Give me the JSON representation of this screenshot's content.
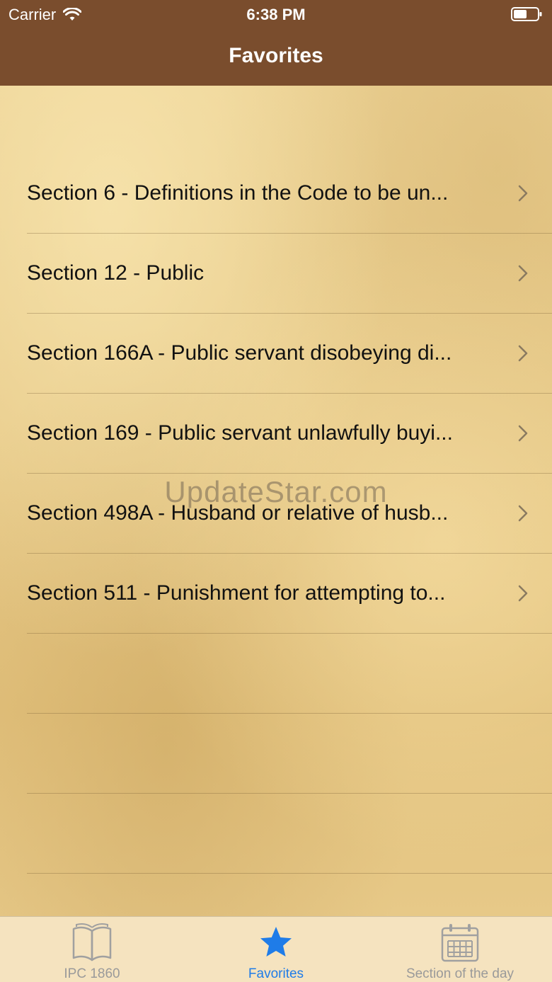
{
  "status_bar": {
    "carrier": "Carrier",
    "time": "6:38 PM",
    "wifi_icon": "wifi-icon",
    "battery_icon": "battery-icon"
  },
  "nav": {
    "title": "Favorites"
  },
  "favorites": [
    {
      "label": "Section 6 - Definitions in the Code to be un..."
    },
    {
      "label": "Section 12 - Public"
    },
    {
      "label": "Section 166A - Public servant disobeying di..."
    },
    {
      "label": "Section 169 - Public servant unlawfully buyi..."
    },
    {
      "label": "Section 498A - Husband or relative of husb..."
    },
    {
      "label": "Section 511 - Punishment for attempting to..."
    }
  ],
  "watermark": "UpdateStar.com",
  "tabbar": {
    "tabs": [
      {
        "label": "IPC 1860",
        "icon": "book-icon",
        "active": false
      },
      {
        "label": "Favorites",
        "icon": "star-icon",
        "active": true
      },
      {
        "label": "Section of the day",
        "icon": "calendar-icon",
        "active": false
      }
    ]
  },
  "colors": {
    "header": "#7a4d2d",
    "tab_active": "#1f7ce8",
    "tab_inactive": "#9a9a9a",
    "tabbar_bg": "#f5e3bf"
  }
}
